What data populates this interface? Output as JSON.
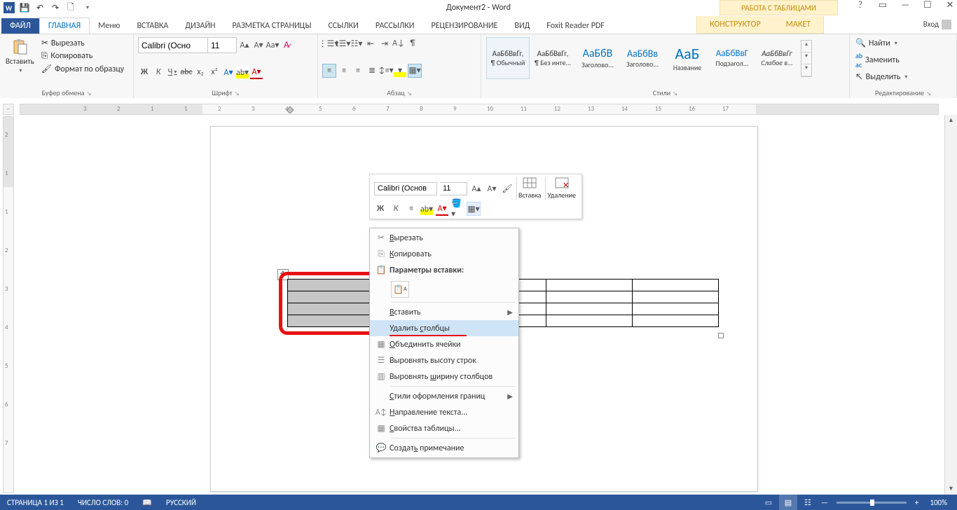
{
  "qat": {
    "save": "💾",
    "undo": "↶",
    "redo": "↷",
    "newdoc": "🗋"
  },
  "titlebar": {
    "title": "Документ2 - Word",
    "tooltab": "РАБОТА С ТАБЛИЦАМИ"
  },
  "winbtns": {
    "help": "?",
    "opts": "▭",
    "min": "—",
    "max": "☐",
    "close": "✕"
  },
  "tabs": {
    "file": "ФАЙЛ",
    "home": "ГЛАВНАЯ",
    "menu": "Меню",
    "insert": "ВСТАВКА",
    "design": "ДИЗАЙН",
    "layout": "РАЗМЕТКА СТРАНИЦЫ",
    "refs": "ССЫЛКИ",
    "mail": "РАССЫЛКИ",
    "review": "РЕЦЕНЗИРОВАНИЕ",
    "view": "ВИД",
    "foxit": "Foxit Reader PDF",
    "construct": "КОНСТРУКТОР",
    "maket": "МАКЕТ",
    "signin": "Вход"
  },
  "groups": {
    "clipboard": {
      "label": "Буфер обмена",
      "paste": "Вставить",
      "cut": "Вырезать",
      "copy": "Копировать",
      "format": "Формат по образцу"
    },
    "font": {
      "label": "Шрифт",
      "name": "Calibri (Осно",
      "size": "11"
    },
    "para": {
      "label": "Абзац"
    },
    "styles": {
      "label": "Стили",
      "s1": "АаБбВвГг,",
      "s1l": "¶ Обычный",
      "s2": "АаБбВвГг,",
      "s2l": "¶ Без инте...",
      "s3": "АаБбВ",
      "s3l": "Заголово...",
      "s4": "АаБбВв",
      "s4l": "Заголово...",
      "s5": "АаБ",
      "s5l": "Название",
      "s6": "АаБбВвГ",
      "s6l": "Подзагол...",
      "s7": "АаБбВвГг",
      "s7l": "Слабое в..."
    },
    "edit": {
      "label": "Редактирование",
      "find": "Найти",
      "replace": "Заменить",
      "select": "Выделить"
    }
  },
  "mini": {
    "font": "Calibri (Основ",
    "size": "11",
    "insert": "Вставка",
    "delete": "Удаление"
  },
  "ctx": {
    "cut": "Вырезать",
    "copy": "Копировать",
    "pasteopts": "Параметры вставки:",
    "insert": "Вставить",
    "delete": "Удалить столбцы",
    "merge": "Объединить ячейки",
    "distrows": "Выровнять высоту строк",
    "distcols": "Выровнять ширину столбцов",
    "borders": "Стили оформления границ",
    "textdir": "Направление текста...",
    "props": "Свойства таблицы...",
    "comment": "Создать примечание"
  },
  "ruler": {
    "ticks": [
      "3",
      "2",
      "1",
      "1",
      "2",
      "3",
      "4",
      "5",
      "6",
      "7",
      "8",
      "9",
      "10",
      "11",
      "12",
      "13",
      "14",
      "15",
      "16",
      "17"
    ],
    "vticks": [
      "2",
      "1",
      "1",
      "2",
      "3",
      "4",
      "5",
      "6",
      "7"
    ]
  },
  "status": {
    "page": "СТРАНИЦА 1 ИЗ 1",
    "words": "ЧИСЛО СЛОВ: 0",
    "lang": "РУССКИЙ",
    "zoom": "100%"
  }
}
